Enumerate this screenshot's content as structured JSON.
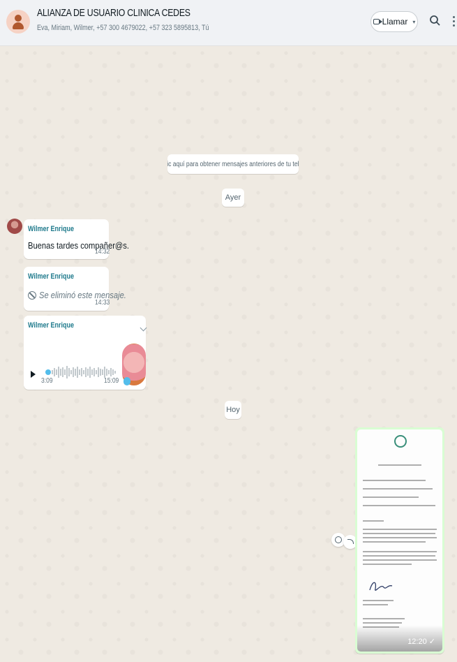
{
  "header": {
    "title": "ALIANZA DE USUARIO CLINICA CEDES",
    "members": "Eva, Miriam, Wilmer, +57 300 4679022, +57 323 5895813, Tú",
    "call_label": "Llamar",
    "call_caret": "▾"
  },
  "chat": {
    "load_older": "Haz clic aquí para obtener mensajes anteriores de tu teléfono.",
    "date_yesterday": "Ayer",
    "date_today": "Hoy",
    "messages": [
      {
        "sender": "Wilmer Enrique",
        "text": "Buenas tardes compañer@s.",
        "time": "14:32"
      },
      {
        "sender": "Wilmer Enrique",
        "text": "Se eliminó este mensaje.",
        "time": "14:33"
      },
      {
        "sender": "Wilmer Enrique",
        "voice_duration": "3:09",
        "time": "15:09"
      }
    ],
    "document": {
      "time": "12:20",
      "status": "✓"
    }
  }
}
